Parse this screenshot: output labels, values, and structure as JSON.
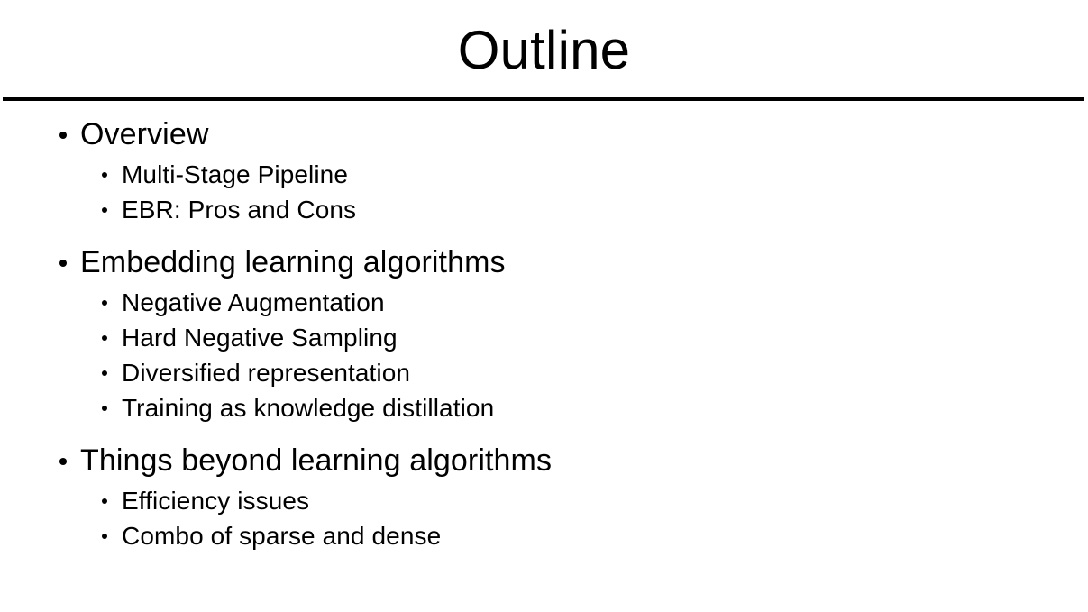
{
  "slide": {
    "title": "Outline",
    "background_color": "#ffffff",
    "text_color": "#000000",
    "rule_color": "#000000",
    "sections": [
      {
        "label": "Overview",
        "items": [
          {
            "label": "Multi-Stage Pipeline"
          },
          {
            "label": "EBR: Pros and Cons"
          }
        ]
      },
      {
        "label": "Embedding learning algorithms",
        "items": [
          {
            "label": "Negative Augmentation"
          },
          {
            "label": "Hard Negative Sampling"
          },
          {
            "label": "Diversified representation"
          },
          {
            "label": "Training as knowledge distillation"
          }
        ]
      },
      {
        "label": "Things beyond learning algorithms",
        "items": [
          {
            "label": "Efficiency issues"
          },
          {
            "label": "Combo of sparse and dense"
          }
        ]
      }
    ]
  }
}
